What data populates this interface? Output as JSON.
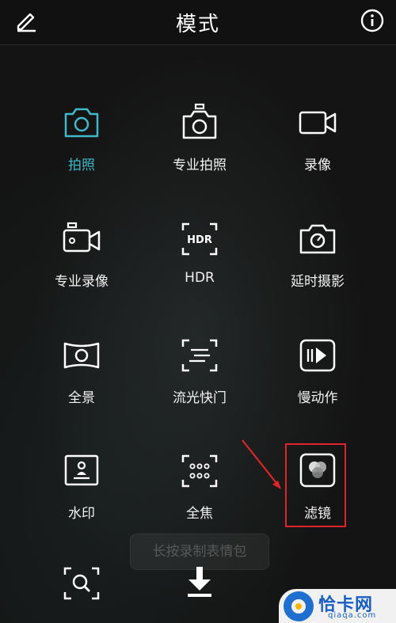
{
  "header": {
    "title": "模式"
  },
  "modes": [
    {
      "label": "拍照",
      "icon": "camera-icon",
      "active": true
    },
    {
      "label": "专业拍照",
      "icon": "pro-camera-icon"
    },
    {
      "label": "录像",
      "icon": "video-icon"
    },
    {
      "label": "专业录像",
      "icon": "pro-video-icon"
    },
    {
      "label": "HDR",
      "icon": "hdr-icon"
    },
    {
      "label": "延时摄影",
      "icon": "timelapse-icon"
    },
    {
      "label": "全景",
      "icon": "panorama-icon"
    },
    {
      "label": "流光快门",
      "icon": "light-painting-icon"
    },
    {
      "label": "慢动作",
      "icon": "slow-motion-icon"
    },
    {
      "label": "水印",
      "icon": "watermark-icon"
    },
    {
      "label": "全焦",
      "icon": "all-focus-icon"
    },
    {
      "label": "滤镜",
      "icon": "filter-icon"
    }
  ],
  "toast": {
    "text": "长按录制表情包"
  },
  "bottom_icons": [
    "document-scan-icon",
    "download-icon"
  ],
  "watermark": {
    "brand": "恰卡网",
    "domain": "qiaqa.com"
  },
  "colors": {
    "active": "#3fb8c9",
    "highlight": "#e0252a",
    "background": "#141414"
  }
}
